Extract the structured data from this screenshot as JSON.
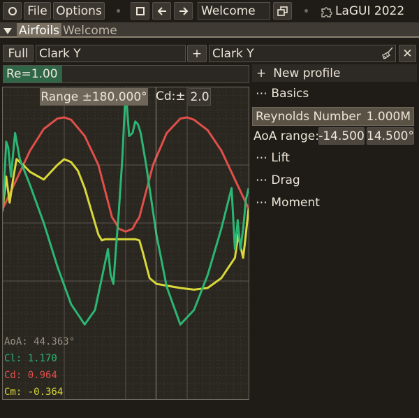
{
  "menubar": {
    "file": "File",
    "options": "Options",
    "welcome": "Welcome",
    "brand": "LaGUI 2022"
  },
  "tabs": {
    "active": "Airfoils",
    "inactive": "Welcome"
  },
  "toolbar": {
    "full": "Full",
    "left_profile": "Clark Y",
    "plus": "+",
    "right_profile": "Clark Y",
    "close": "✕"
  },
  "re_bar": {
    "label": "Re=1.00",
    "fill_fraction": 0.24
  },
  "plot": {
    "range_label": "Range  ±180.000°",
    "cd_label": "Cd:±",
    "cd_value": "2.0",
    "readout": {
      "aoa": "AoA: 44.363°",
      "cl": "Cl: 1.170",
      "cd": "Cd: 0.964",
      "cm": "Cm: -0.364"
    },
    "colors": {
      "cl": "#2bb673",
      "cd": "#e0504a",
      "cm": "#d8d83a"
    }
  },
  "panel": {
    "new_profile": "New profile",
    "new_profile_prefix": "+",
    "basics": "⋯ Basics",
    "reynolds_label": "Reynolds Number",
    "reynolds_value": "1.000M",
    "aoa_label": "AoA range:",
    "aoa_min": "-14.500",
    "aoa_max": "14.500°",
    "lift": "⋯ Lift",
    "drag": "⋯ Drag",
    "moment": "⋯ Moment"
  },
  "chart_data": {
    "type": "line",
    "x_range": [
      -180,
      180
    ],
    "cursor_aoa": 44.363,
    "series": [
      {
        "key": "cd",
        "x": [
          -180,
          -160,
          -140,
          -120,
          -100,
          -90,
          -80,
          -60,
          -40,
          -20,
          -14.5,
          -10,
          0,
          10,
          14.5,
          20,
          40,
          60,
          80,
          90,
          100,
          120,
          140,
          160,
          180
        ],
        "y": [
          0.25,
          0.75,
          1.25,
          1.62,
          1.8,
          1.82,
          1.78,
          1.5,
          1.0,
          0.1,
          0.0,
          -0.1,
          -0.15,
          -0.1,
          0.0,
          0.1,
          1.0,
          1.55,
          1.8,
          1.82,
          1.78,
          1.6,
          1.25,
          0.75,
          0.25
        ]
      },
      {
        "key": "cl",
        "x": [
          -180,
          -175,
          -172,
          -168,
          -162,
          -155,
          -140,
          -120,
          -100,
          -80,
          -60,
          -45,
          -35,
          -26,
          -22,
          -18,
          -14,
          -10,
          -5,
          0,
          5,
          10,
          14,
          18,
          22,
          30,
          45,
          60,
          80,
          100,
          120,
          140,
          155,
          160,
          164,
          168,
          172,
          176,
          180
        ],
        "y": [
          0.2,
          1.4,
          1.3,
          0.8,
          1.55,
          1.1,
          0.65,
          0.0,
          -0.75,
          -1.4,
          -1.75,
          -1.5,
          -0.95,
          -0.45,
          -0.9,
          -1.05,
          -0.4,
          0.2,
          1.1,
          2.3,
          1.5,
          1.55,
          1.75,
          1.7,
          1.55,
          1.0,
          -0.2,
          -1.1,
          -1.75,
          -1.5,
          -0.9,
          -0.1,
          0.6,
          -0.45,
          0.05,
          -0.45,
          -0.1,
          0.4,
          0.6
        ]
      },
      {
        "key": "cm",
        "x": [
          -180,
          -175,
          -170,
          -165,
          -160,
          -150,
          -140,
          -120,
          -100,
          -90,
          -80,
          -70,
          -60,
          -50,
          -40,
          -35,
          -30,
          -20,
          -14,
          -5,
          0,
          5,
          14,
          20,
          25,
          35,
          45,
          60,
          80,
          100,
          120,
          140,
          160,
          165,
          168,
          172,
          175,
          180
        ],
        "y": [
          0.25,
          0.8,
          0.35,
          0.75,
          1.1,
          1.0,
          0.88,
          0.75,
          1.0,
          1.1,
          1.05,
          0.9,
          0.6,
          0.2,
          -0.2,
          -0.3,
          -0.28,
          -0.28,
          -0.28,
          -0.28,
          -0.28,
          -0.28,
          -0.28,
          -0.3,
          -0.5,
          -0.95,
          -1.05,
          -1.08,
          -1.12,
          -1.15,
          -1.12,
          -0.95,
          -0.6,
          -0.2,
          -0.4,
          -0.6,
          -0.3,
          0.25
        ]
      }
    ]
  }
}
